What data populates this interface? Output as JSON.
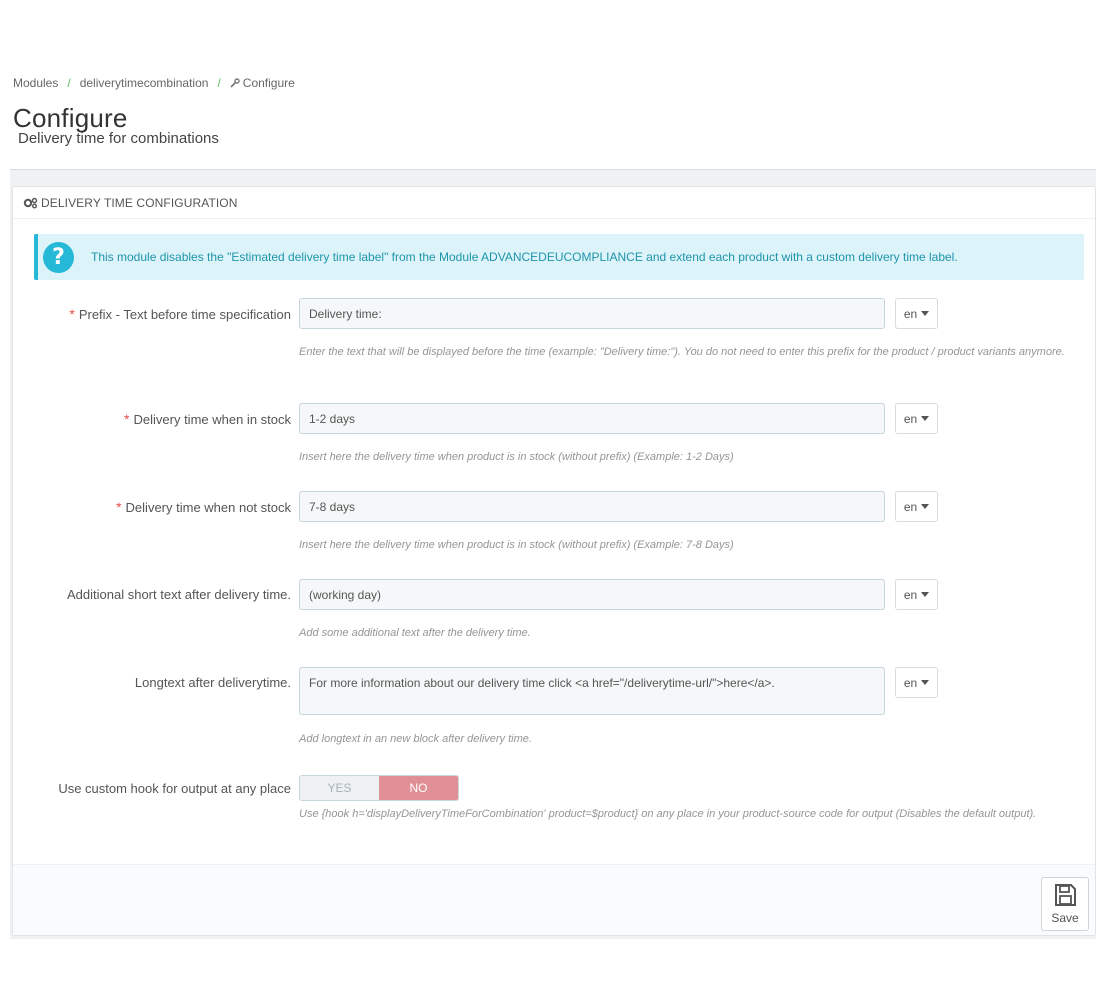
{
  "breadcrumb": {
    "items": [
      "Modules",
      "deliverytimecombination",
      "Configure"
    ]
  },
  "page": {
    "title": "Configure",
    "subtitle": "Delivery time for combinations"
  },
  "panel": {
    "heading": "DELIVERY TIME CONFIGURATION",
    "heading_icon": "cogs-icon"
  },
  "alert": {
    "icon": "question-icon",
    "text": "This module disables the \"Estimated delivery time label\" from the Module ADVANCEDEUCOMPLIANCE and extend each product with a custom delivery time label."
  },
  "fields": [
    {
      "label": "Prefix - Text before time specification",
      "required": true,
      "value": "Delivery time:",
      "lang": "en",
      "help": "Enter the text that will be displayed before the time (example: \"Delivery time:\"). You do not need to enter this prefix for the product / product variants anymore."
    },
    {
      "label": "Delivery time when in stock",
      "required": true,
      "value": "1-2 days",
      "lang": "en",
      "help": "Insert here the delivery time when product is in stock (without prefix) (Example: 1-2 Days)"
    },
    {
      "label": "Delivery time when not stock",
      "required": true,
      "value": "7-8 days",
      "lang": "en",
      "help": "Insert here the delivery time when product is in stock (without prefix) (Example: 7-8 Days)"
    },
    {
      "label": "Additional short text after delivery time.",
      "required": false,
      "value": "(working day)",
      "lang": "en",
      "help": "Add some additional text after the delivery time."
    },
    {
      "label": "Longtext after deliverytime.",
      "required": false,
      "value": "For more information about our delivery time click <a href=\"/deliverytime-url/\">here</a>.",
      "lang": "en",
      "help": "Add longtext in an new block after delivery time."
    }
  ],
  "hook_switch": {
    "label": "Use custom hook for output at any place",
    "yes_label": "YES",
    "no_label": "NO",
    "selected": "NO",
    "help": "Use {hook h='displayDeliveryTimeForCombination' product=$product} on any place in your product-source code for output (Disables the default output)."
  },
  "footer": {
    "save_label": "Save",
    "save_icon": "save-icon"
  },
  "colors": {
    "accent": "#25b9d7",
    "required": "#e84e4e",
    "switch_no": "#e08f95",
    "breadcrumb_sep": "#5cb85c"
  }
}
